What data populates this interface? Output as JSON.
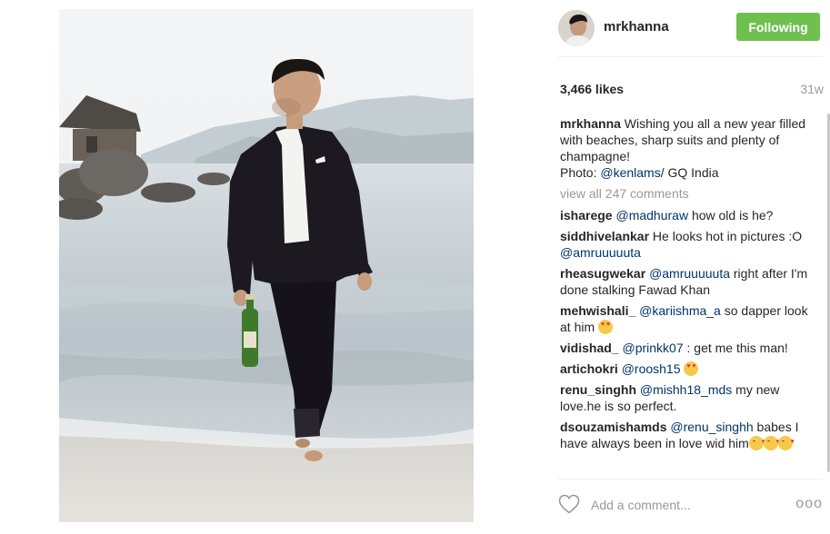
{
  "post": {
    "username": "mrkhanna",
    "follow_label": "Following",
    "likes": "3,466 likes",
    "age": "31w",
    "caption": {
      "user": "mrkhanna",
      "text1": " Wishing you all a new year filled with beaches, sharp suits and plenty of champagne!",
      "text2": "Photo: ",
      "mention": "@kenlams",
      "text3": "/ GQ India"
    },
    "view_all": "view all 247 comments"
  },
  "comments": [
    {
      "user": "isharege",
      "mention": "@madhuraw",
      "text": " how old is he?"
    },
    {
      "user": "siddhivelankar",
      "text": " He looks hot in pictures :O ",
      "mention": "@amruuuuuta"
    },
    {
      "user": "rheasugwekar",
      "mention": "@amruuuuuta",
      "text": " right after I'm done stalking Fawad Khan"
    },
    {
      "user": "mehwishali_",
      "mention": "@kariishma_a",
      "text": " so dapper look at him "
    },
    {
      "user": "vidishad_",
      "mention": "@prinkk07",
      "text": " : get me this man!"
    },
    {
      "user": "artichokri",
      "mention": "@roosh15",
      "text": " "
    },
    {
      "user": "renu_singhh",
      "mention": "@mishh18_mds",
      "text": " my new love.he is so perfect."
    },
    {
      "user": "dsouzamishamds",
      "mention": "@renu_singhh",
      "text": " babes I have always been in love wid him"
    }
  ],
  "footer": {
    "comment_placeholder": "Add a comment...",
    "more_label": "ooo"
  },
  "icons": {
    "like": "heart-outline-icon",
    "more": "more-options-icon",
    "emoji_heart_eyes": "heart-eyes-emoji-icon",
    "emoji_kiss": "kiss-emoji-icon"
  },
  "colors": {
    "follow_button": "#70c050",
    "mention": "#003569",
    "muted": "#999999"
  }
}
